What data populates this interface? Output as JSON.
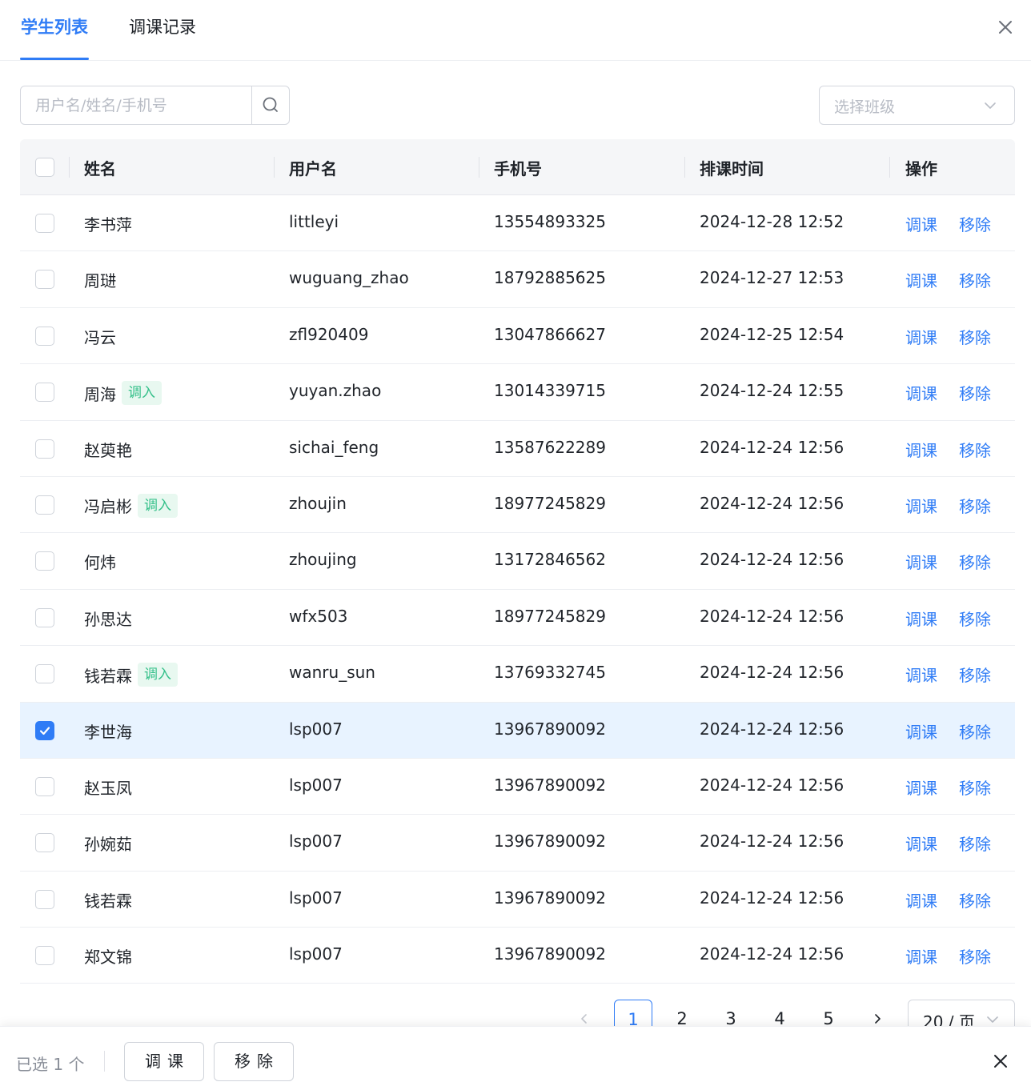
{
  "tabs": [
    {
      "label": "学生列表",
      "active": true
    },
    {
      "label": "调课记录",
      "active": false
    }
  ],
  "search": {
    "placeholder": "用户名/姓名/手机号",
    "value": ""
  },
  "class_select": {
    "placeholder": "选择班级"
  },
  "table": {
    "columns": [
      "姓名",
      "用户名",
      "手机号",
      "排课时间",
      "操作"
    ],
    "action_adjust": "调课",
    "action_remove": "移除",
    "rows": [
      {
        "name": "李书萍",
        "tag": "",
        "username": "littleyi",
        "phone": "13554893325",
        "time": "2024-12-28 12:52",
        "checked": false
      },
      {
        "name": "周琎",
        "tag": "",
        "username": "wuguang_zhao",
        "phone": "18792885625",
        "time": "2024-12-27 12:53",
        "checked": false
      },
      {
        "name": "冯云",
        "tag": "",
        "username": "zfl920409",
        "phone": "13047866627",
        "time": "2024-12-25 12:54",
        "checked": false
      },
      {
        "name": "周海",
        "tag": "调入",
        "username": "yuyan.zhao",
        "phone": "13014339715",
        "time": "2024-12-24 12:55",
        "checked": false
      },
      {
        "name": "赵萸艳",
        "tag": "",
        "username": "sichai_feng",
        "phone": "13587622289",
        "time": "2024-12-24 12:56",
        "checked": false
      },
      {
        "name": "冯启彬",
        "tag": "调入",
        "username": "zhoujin",
        "phone": "18977245829",
        "time": "2024-12-24 12:56",
        "checked": false
      },
      {
        "name": "何炜",
        "tag": "",
        "username": "zhoujing",
        "phone": "13172846562",
        "time": "2024-12-24 12:56",
        "checked": false
      },
      {
        "name": "孙思达",
        "tag": "",
        "username": "wfx503",
        "phone": "18977245829",
        "time": "2024-12-24 12:56",
        "checked": false
      },
      {
        "name": "钱若霖",
        "tag": "调入",
        "username": "wanru_sun",
        "phone": "13769332745",
        "time": "2024-12-24 12:56",
        "checked": false
      },
      {
        "name": "李世海",
        "tag": "",
        "username": "lsp007",
        "phone": "13967890092",
        "time": "2024-12-24 12:56",
        "checked": true
      },
      {
        "name": "赵玉凤",
        "tag": "",
        "username": "lsp007",
        "phone": "13967890092",
        "time": "2024-12-24 12:56",
        "checked": false
      },
      {
        "name": "孙婉茹",
        "tag": "",
        "username": "lsp007",
        "phone": "13967890092",
        "time": "2024-12-24 12:56",
        "checked": false
      },
      {
        "name": "钱若霖",
        "tag": "",
        "username": "lsp007",
        "phone": "13967890092",
        "time": "2024-12-24 12:56",
        "checked": false
      },
      {
        "name": "郑文锦",
        "tag": "",
        "username": "lsp007",
        "phone": "13967890092",
        "time": "2024-12-24 12:56",
        "checked": false
      }
    ]
  },
  "pagination": {
    "pages": [
      "1",
      "2",
      "3",
      "4",
      "5"
    ],
    "current": "1",
    "page_size": "20 / 页"
  },
  "bottom_bar": {
    "selected_text": "已选 1 个",
    "adjust_label": "调课",
    "remove_label": "移除"
  },
  "colors": {
    "accent": "#2f7cf6",
    "tag_text": "#35c08a",
    "tag_bg": "#e8f8f0",
    "selected_row_bg": "#e8f3ff"
  }
}
